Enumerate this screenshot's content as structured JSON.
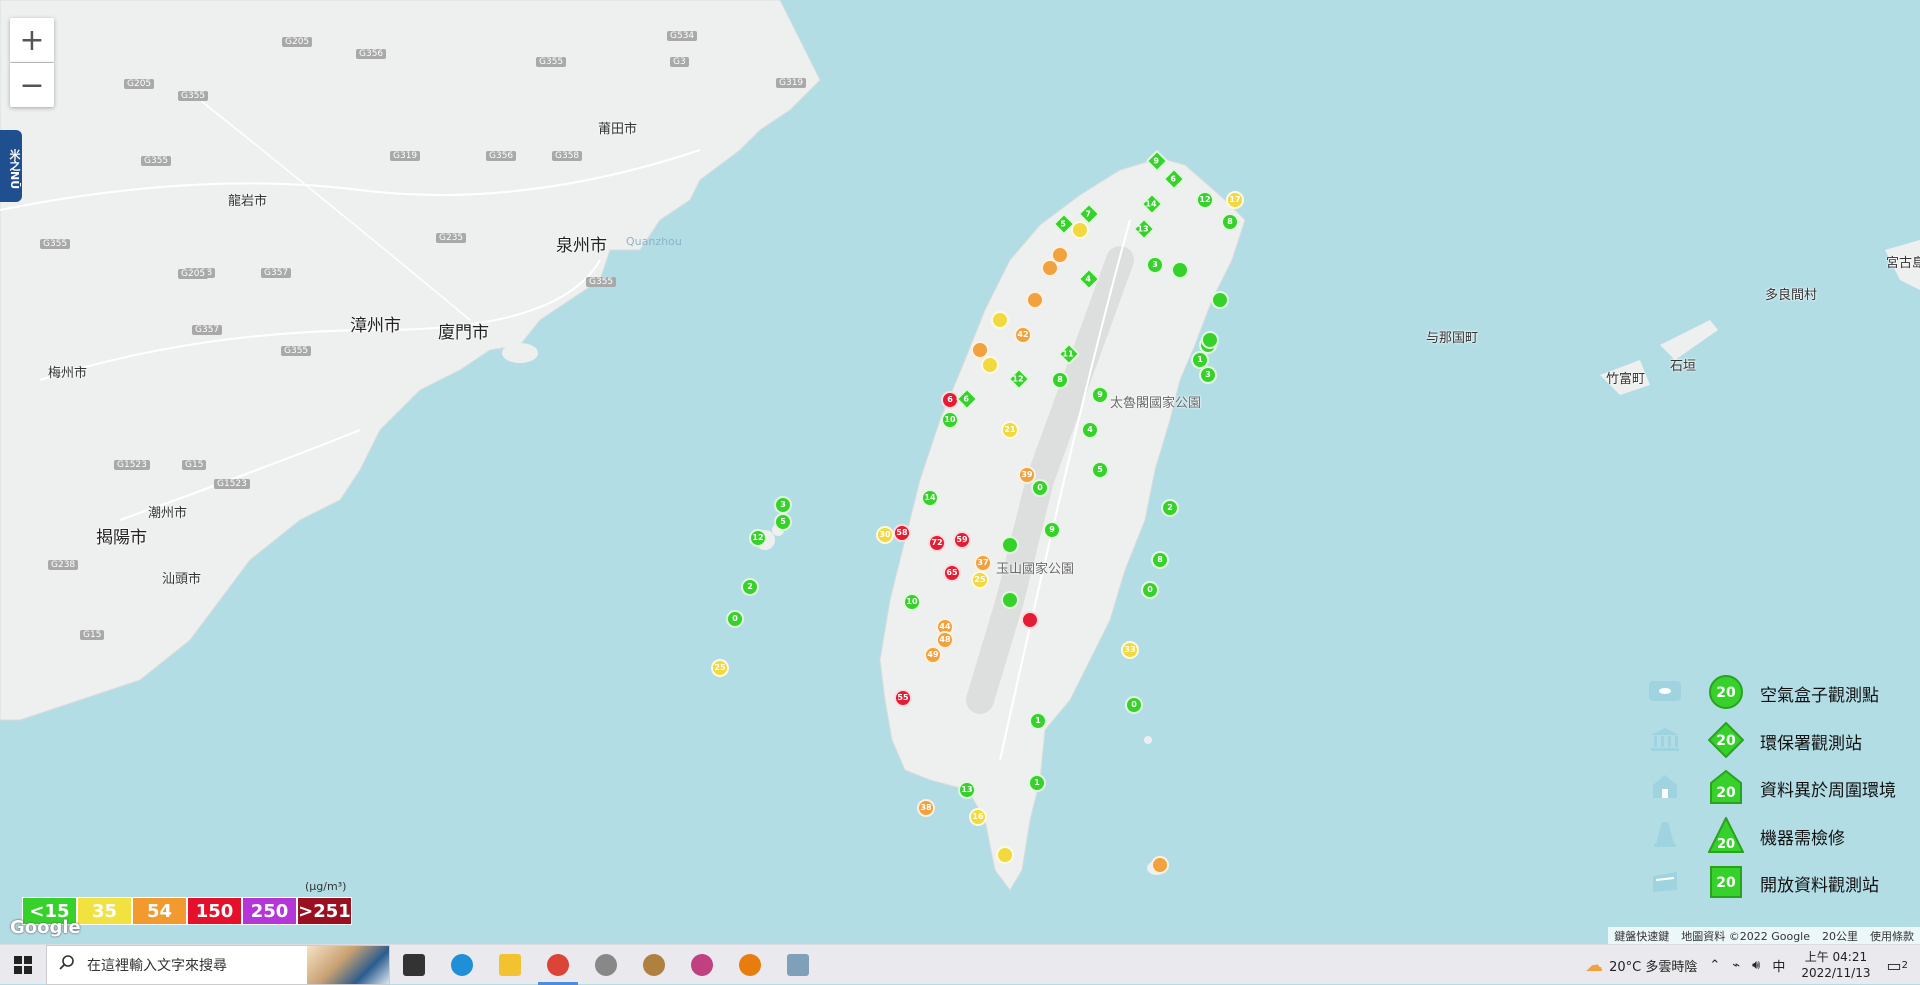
{
  "map": {
    "zoom_in": "+",
    "zoom_out": "−",
    "side_tab": "米之NŪ",
    "places": [
      {
        "id": "putian",
        "name": "莆田市"
      },
      {
        "id": "longyan",
        "name": "龍岩市"
      },
      {
        "id": "quanzhou",
        "name": "泉州市"
      },
      {
        "id": "quanzhou_sea",
        "name": "Quanzhou"
      },
      {
        "id": "zhangzhou",
        "name": "漳州市"
      },
      {
        "id": "xiamen",
        "name": "廈門市"
      },
      {
        "id": "meizhou",
        "name": "梅州市"
      },
      {
        "id": "chaozhou",
        "name": "潮州市"
      },
      {
        "id": "jieyang",
        "name": "揭陽市"
      },
      {
        "id": "shantou",
        "name": "汕頭市"
      },
      {
        "id": "yonaguni",
        "name": "与那国町"
      },
      {
        "id": "taketomi",
        "name": "竹富町"
      },
      {
        "id": "ishigaki",
        "name": "石垣"
      },
      {
        "id": "tarama",
        "name": "多良間村"
      },
      {
        "id": "miyako",
        "name": "宮古島"
      },
      {
        "id": "taroko",
        "name": "太魯閣國家公園"
      },
      {
        "id": "yushan",
        "name": "玉山國家公園"
      }
    ],
    "roads": [
      "G205",
      "G356",
      "G355",
      "G534",
      "G3",
      "G319",
      "G205",
      "G355",
      "G356",
      "G319",
      "G358",
      "G355",
      "G355",
      "G235",
      "G228",
      "G357",
      "G205",
      "G355",
      "G357",
      "G355",
      "G1523",
      "G15",
      "G1523",
      "G238",
      "G15"
    ]
  },
  "markers": [
    {
      "v": "9",
      "c": "#37d12c",
      "s": "d"
    },
    {
      "v": "6",
      "c": "#37d12c",
      "s": "d"
    },
    {
      "v": "12",
      "c": "#37d12c",
      "s": "c"
    },
    {
      "v": "14",
      "c": "#37d12c",
      "s": "d"
    },
    {
      "v": "17",
      "c": "#f2d93f",
      "s": "c"
    },
    {
      "v": "13",
      "c": "#37d12c",
      "s": "d"
    },
    {
      "v": "7",
      "c": "#37d12c",
      "s": "d"
    },
    {
      "v": "5",
      "c": "#37d12c",
      "s": "d"
    },
    {
      "v": "8",
      "c": "#37d12c",
      "s": "c"
    },
    {
      "v": "3",
      "c": "#37d12c",
      "s": "c"
    },
    {
      "v": "4",
      "c": "#37d12c",
      "s": "d"
    },
    {
      "v": "2",
      "c": "#37d12c",
      "s": "c"
    },
    {
      "v": "42",
      "c": "#f2a13f",
      "s": "c"
    },
    {
      "v": "6",
      "c": "#e11e33",
      "s": "c"
    },
    {
      "v": "10",
      "c": "#37d12c",
      "s": "c"
    },
    {
      "v": "6",
      "c": "#37d12c",
      "s": "d"
    },
    {
      "v": "39",
      "c": "#f2a13f",
      "s": "c"
    },
    {
      "v": "0",
      "c": "#37d12c",
      "s": "c"
    },
    {
      "v": "14",
      "c": "#37d12c",
      "s": "c"
    },
    {
      "v": "58",
      "c": "#e11e33",
      "s": "c"
    },
    {
      "v": "72",
      "c": "#e11e33",
      "s": "c"
    },
    {
      "v": "59",
      "c": "#e11e33",
      "s": "c"
    },
    {
      "v": "65",
      "c": "#e11e33",
      "s": "c"
    },
    {
      "v": "37",
      "c": "#f2a13f",
      "s": "c"
    },
    {
      "v": "25",
      "c": "#f2d93f",
      "s": "c"
    },
    {
      "v": "10",
      "c": "#37d12c",
      "s": "c"
    },
    {
      "v": "44",
      "c": "#f2a13f",
      "s": "c"
    },
    {
      "v": "48",
      "c": "#f2a13f",
      "s": "c"
    },
    {
      "v": "49",
      "c": "#f2a13f",
      "s": "c"
    },
    {
      "v": "55",
      "c": "#e11e33",
      "s": "c"
    },
    {
      "v": "38",
      "c": "#f2a13f",
      "s": "c"
    },
    {
      "v": "16",
      "c": "#f2d93f",
      "s": "c"
    },
    {
      "v": "13",
      "c": "#37d12c",
      "s": "c"
    },
    {
      "v": "1",
      "c": "#37d12c",
      "s": "c"
    },
    {
      "v": "3",
      "c": "#37d12c",
      "s": "c"
    },
    {
      "v": "5",
      "c": "#37d12c",
      "s": "c"
    },
    {
      "v": "2",
      "c": "#37d12c",
      "s": "c"
    },
    {
      "v": "0",
      "c": "#37d12c",
      "s": "c"
    },
    {
      "v": "25",
      "c": "#f2d93f",
      "s": "c"
    },
    {
      "v": "12",
      "c": "#37d12c",
      "s": "c"
    },
    {
      "v": "9",
      "c": "#37d12c",
      "s": "c"
    },
    {
      "v": "33",
      "c": "#f2d93f",
      "s": "c"
    },
    {
      "v": "0",
      "c": "#37d12c",
      "s": "c"
    },
    {
      "v": "11",
      "c": "#37d12c",
      "s": "d"
    },
    {
      "v": "8",
      "c": "#37d12c",
      "s": "c"
    },
    {
      "v": "4",
      "c": "#37d12c",
      "s": "c"
    },
    {
      "v": "1",
      "c": "#37d12c",
      "s": "c"
    },
    {
      "v": "3",
      "c": "#37d12c",
      "s": "c"
    },
    {
      "v": "2",
      "c": "#37d12c",
      "s": "c"
    },
    {
      "v": "8",
      "c": "#37d12c",
      "s": "c"
    },
    {
      "v": "0",
      "c": "#37d12c",
      "s": "c"
    },
    {
      "v": "9",
      "c": "#37d12c",
      "s": "c"
    },
    {
      "v": "5",
      "c": "#37d12c",
      "s": "c"
    },
    {
      "v": "1",
      "c": "#37d12c",
      "s": "c"
    },
    {
      "v": "30",
      "c": "#f2d93f",
      "s": "c"
    },
    {
      "v": "12",
      "c": "#37d12c",
      "s": "d"
    },
    {
      "v": "21",
      "c": "#f2d93f",
      "s": "c"
    },
    {
      "v": "",
      "c": "#f2a13f",
      "s": "c"
    },
    {
      "v": "",
      "c": "#f2a13f",
      "s": "c"
    },
    {
      "v": "",
      "c": "#f2d93f",
      "s": "c"
    },
    {
      "v": "",
      "c": "#f2a13f",
      "s": "c"
    },
    {
      "v": "",
      "c": "#f2d93f",
      "s": "c"
    },
    {
      "v": "",
      "c": "#f2a13f",
      "s": "c"
    },
    {
      "v": "",
      "c": "#f2d93f",
      "s": "c"
    },
    {
      "v": "",
      "c": "#37d12c",
      "s": "c"
    },
    {
      "v": "",
      "c": "#37d12c",
      "s": "c"
    },
    {
      "v": "",
      "c": "#37d12c",
      "s": "c"
    },
    {
      "v": "",
      "c": "#37d12c",
      "s": "c"
    },
    {
      "v": "",
      "c": "#37d12c",
      "s": "c"
    },
    {
      "v": "",
      "c": "#e11e33",
      "s": "c"
    },
    {
      "v": "",
      "c": "#f2a13f",
      "s": "c"
    },
    {
      "v": "",
      "c": "#f2d93f",
      "s": "c"
    }
  ],
  "legend": [
    {
      "icon": "cloud-box-icon",
      "shape": "circle",
      "value": "20",
      "label": "空氣盒子觀測點"
    },
    {
      "icon": "government-building-icon",
      "shape": "diamond",
      "value": "20",
      "label": "環保署觀測站"
    },
    {
      "icon": "house-icon",
      "shape": "house",
      "value": "20",
      "label": "資料異於周圍環境"
    },
    {
      "icon": "traffic-cone-icon",
      "shape": "triangle",
      "value": "20",
      "label": "機器需檢修"
    },
    {
      "icon": "open-data-icon",
      "shape": "square",
      "value": "20",
      "label": "開放資料觀測站"
    }
  ],
  "scale": {
    "unit": "(μg/m³)",
    "bands": [
      {
        "label": "<15",
        "color": "#37d12c"
      },
      {
        "label": "35",
        "color": "#f2e23f"
      },
      {
        "label": "54",
        "color": "#f29a2e"
      },
      {
        "label": "150",
        "color": "#e5102a"
      },
      {
        "label": "250",
        "color": "#b536d6"
      },
      {
        "label": ">251",
        "color": "#9a1020"
      }
    ]
  },
  "attribution": {
    "logo": "Google",
    "shortcuts": "鍵盤快速鍵",
    "mapdata": "地圖資料 ©2022 Google",
    "scale": "20公里",
    "terms": "使用條款"
  },
  "taskbar": {
    "search_placeholder": "在這裡輸入文字來搜尋",
    "apps": [
      "task-view-icon",
      "edge-icon",
      "file-explorer-icon",
      "chrome-icon",
      "app-compass-icon",
      "app-bird-icon",
      "app-butterfly-icon",
      "blender-icon",
      "app-files-icon"
    ],
    "weather": "20°C  多雲時陰",
    "ime": "中",
    "time": "上午 04:21",
    "date": "2022/11/13",
    "notifications": "2"
  }
}
